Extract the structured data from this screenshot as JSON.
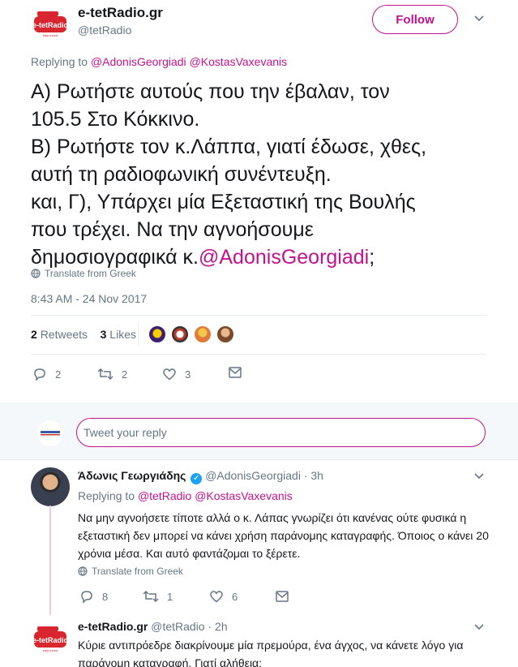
{
  "tweet": {
    "display_name": "e-tetRadio.gr",
    "handle": "@tetRadio",
    "follow_label": "Follow",
    "replying_prefix": "Replying to",
    "replying_to": [
      "@AdonisGeorgiadi",
      "@KostasVaxevanis"
    ],
    "text_lines": "Α) Ρωτήστε αυτούς που την έβαλαν, τον\n105.5 Στο Κόκκινο.\nΒ) Ρωτήστε τον κ.Λάππα, γιατί έδωσε, χθες,\nαυτή τη ραδιοφωνική συνέντευξη.\nκαι, Γ), Υπάρχει μία Εξεταστική της Βουλής\nπου τρέχει. Να την αγνοήσουμε\nδημοσιογραφικά κ.",
    "text_mention": "@AdonisGeorgiadi",
    "text_end": ";",
    "translate_label": "Translate from Greek",
    "timestamp": "8:43 AM - 24 Nov 2017",
    "retweets_count": "2",
    "retweets_label": "Retweets",
    "likes_count": "3",
    "likes_label": "Likes",
    "reply_count": "2",
    "retweet_count": "2",
    "like_count": "3"
  },
  "reply_box": {
    "placeholder": "Tweet your reply"
  },
  "reply1": {
    "display_name": "Άδωνις Γεωργιάδης",
    "handle": "@AdonisGeorgiadi",
    "time": "· 3h",
    "replying_prefix": "Replying to",
    "replying_to": [
      "@tetRadio",
      "@KostasVaxevanis"
    ],
    "text": "Να μην αγνοήσετε τίποτε αλλά ο κ. Λάπας γνωρίζει ότι κανένας ούτε φυσικά η εξεταστική δεν μπορεί να κάνει χρήση παράνομης καταγραφής. Όποιος ο κάνει 20 χρόνια μέσα. Και αυτό φαντάζομαι το ξέρετε.",
    "translate_label": "Translate from Greek",
    "reply_count": "8",
    "retweet_count": "1",
    "like_count": "6"
  },
  "reply2": {
    "display_name": "e-tetRadio.gr",
    "handle": "@tetRadio",
    "time": "· 2h",
    "text": "Κύριε αντιπρόεδρε διακρίνουμε μία πρεμούρα, ένα άγχος, να κάνετε λόγο για παράνομη καταγραφή. Γιατί αλήθεια;"
  },
  "colors": {
    "accent": "#c3138c",
    "muted": "#657786",
    "text": "#14171a",
    "radio_red": "#d9262e"
  }
}
